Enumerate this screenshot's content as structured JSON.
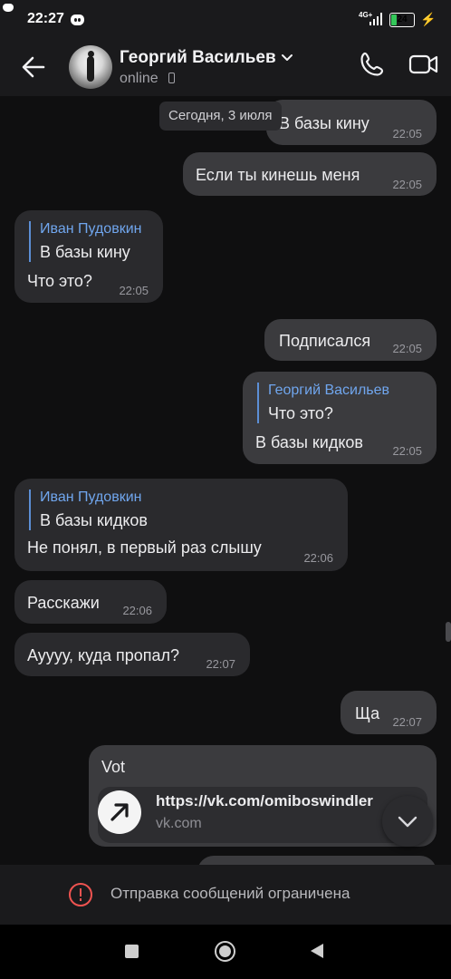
{
  "status_bar": {
    "time": "22:27",
    "network": "4G+",
    "battery": "24",
    "battery_fraction": 0.24
  },
  "header": {
    "name": "Георгий Васильев",
    "status": "online"
  },
  "chat": {
    "date_chip": "Сегодня, 3 июля",
    "messages": [
      {
        "id": "m1",
        "text": "В базы кину",
        "time": "22:05"
      },
      {
        "id": "m2",
        "text": "Если ты кинешь меня",
        "time": "22:05"
      },
      {
        "id": "m3",
        "reply_name": "Иван Пудовкин",
        "reply_text": "В базы кину",
        "text": "Что это?",
        "time": "22:05"
      },
      {
        "id": "m4",
        "text": "Подписался",
        "time": "22:05"
      },
      {
        "id": "m5",
        "reply_name": "Георгий Васильев",
        "reply_text": "Что это?",
        "text": "В базы кидков",
        "time": "22:05"
      },
      {
        "id": "m6",
        "reply_name": "Иван Пудовкин",
        "reply_text": "В базы кидков",
        "text": "Не понял, в первый раз слышу",
        "time": "22:06"
      },
      {
        "id": "m7",
        "text": "Расскажи",
        "time": "22:06"
      },
      {
        "id": "m8",
        "text": "Ауууу, куда пропал?",
        "time": "22:07"
      },
      {
        "id": "m9",
        "text": "Ща",
        "time": "22:07"
      },
      {
        "id": "m10",
        "text": "Vot",
        "link_url": "https://vk.com/omiboswindler",
        "link_domain": "vk.com"
      }
    ]
  },
  "footer": {
    "restriction_text": "Отправка сообщений ограничена"
  },
  "icons": {
    "back": "arrow-left-icon",
    "call": "phone-icon",
    "video": "video-camera-icon",
    "dropdown": "chevron-down-icon",
    "scroll": "chevron-down-icon",
    "link": "arrow-up-right-icon",
    "warning": "exclamation-circle-icon"
  },
  "colors": {
    "accent": "#70a6ee",
    "warning": "#ef5350",
    "battery": "#34c759"
  }
}
